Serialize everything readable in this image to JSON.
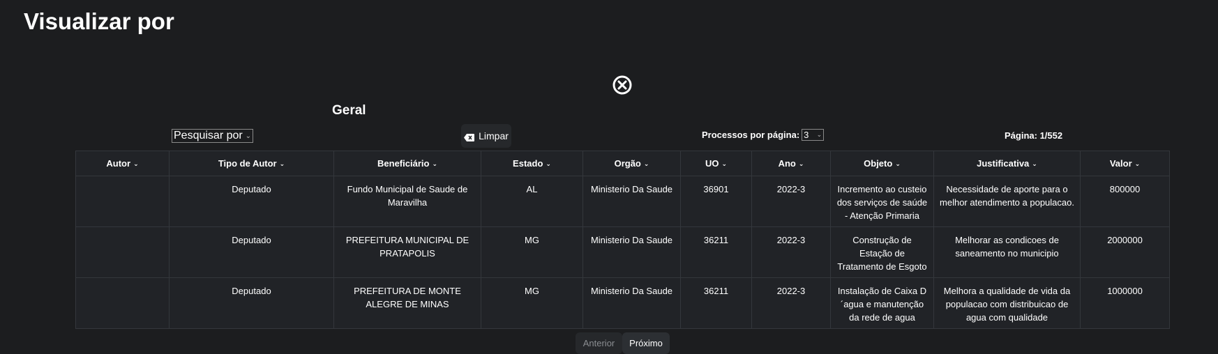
{
  "header": {
    "title": "Visualizar por"
  },
  "section": {
    "title": "Geral"
  },
  "filters": {
    "search_by": "Pesquisar por",
    "clear_label": "Limpar",
    "per_page_label": "Processos por página:",
    "per_page_value": "3",
    "page_label": "Página: 1/552"
  },
  "table": {
    "columns": [
      "Autor",
      "Tipo de Autor",
      "Beneficiário",
      "Estado",
      "Orgão",
      "UO",
      "Ano",
      "Objeto",
      "Justificativa",
      "Valor"
    ],
    "rows": [
      [
        "",
        "Deputado",
        "Fundo Municipal de Saude de Maravilha",
        "AL",
        "Ministerio Da Saude",
        "36901",
        "2022-3",
        "Incremento ao custeio dos serviços de saúde - Atenção Primaria",
        "Necessidade de aporte para o melhor atendimento a populacao.",
        "800000"
      ],
      [
        "",
        "Deputado",
        "PREFEITURA MUNICIPAL DE PRATAPOLIS",
        "MG",
        "Ministerio Da Saude",
        "36211",
        "2022-3",
        "Construção de Estação de Tratamento de Esgoto",
        "Melhorar as condicoes de saneamento no municipio",
        "2000000"
      ],
      [
        "",
        "Deputado",
        "PREFEITURA DE MONTE ALEGRE DE MINAS",
        "MG",
        "Ministerio Da Saude",
        "36211",
        "2022-3",
        "Instalação de Caixa D ´agua e manutenção da rede de agua",
        "Melhora a qualidade de vida da populacao com distribuicao de agua com qualidade",
        "1000000"
      ]
    ]
  },
  "pagination": {
    "prev": "Anterior",
    "next": "Próximo"
  },
  "icons": {
    "close": "close-circle-icon",
    "clear": "backspace-icon",
    "sort": "chevron-down-icon"
  }
}
